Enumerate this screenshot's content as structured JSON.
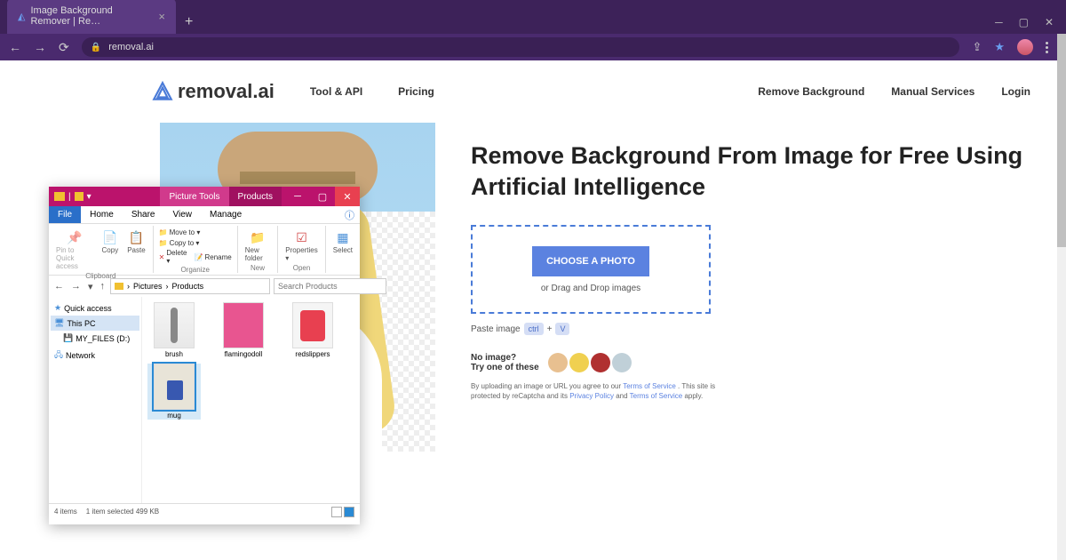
{
  "browser": {
    "tab_title": "Image Background Remover | Re…",
    "url": "removal.ai",
    "new_tab_glyph": "+"
  },
  "site": {
    "logo_text": "removal.ai",
    "nav": {
      "tool_api": "Tool & API",
      "pricing": "Pricing",
      "remove_bg": "Remove Background",
      "manual": "Manual Services",
      "login": "Login"
    },
    "headline": "Remove Background From Image for Free Using Artificial Intelligence",
    "choose_btn": "CHOOSE A PHOTO",
    "drag_text": "or Drag and Drop images",
    "paste_label": "Paste image",
    "key_ctrl": "ctrl",
    "key_plus": "+",
    "key_v": "V",
    "noimg_line1": "No image?",
    "noimg_line2": "Try one of these",
    "terms_pre": "By uploading an image or URL you agree to our ",
    "terms_tos": "Terms of Service",
    "terms_mid": " . This site is protected by reCaptcha and its ",
    "terms_pp": "Privacy Policy",
    "terms_and": " and ",
    "terms_tos2": "Terms of Service",
    "terms_post": " apply."
  },
  "explorer": {
    "title_tabs": {
      "picture_tools": "Picture Tools",
      "products": "Products"
    },
    "menubar": {
      "file": "File",
      "home": "Home",
      "share": "Share",
      "view": "View",
      "manage": "Manage"
    },
    "ribbon": {
      "pin": "Pin to Quick access",
      "copy": "Copy",
      "paste": "Paste",
      "move_to": "Move to ▾",
      "copy_to": "Copy to ▾",
      "delete": "Delete ▾",
      "rename": "Rename",
      "new_folder": "New folder",
      "properties": "Properties ▾",
      "select": "Select",
      "g_clipboard": "Clipboard",
      "g_organize": "Organize",
      "g_new": "New",
      "g_open": "Open"
    },
    "path": {
      "pictures": "Pictures",
      "products": "Products"
    },
    "search_placeholder": "Search Products",
    "sidebar": {
      "quick": "Quick access",
      "this_pc": "This PC",
      "my_files": "MY_FILES (D:)",
      "network": "Network"
    },
    "files": {
      "brush": "brush",
      "flamingodoll": "flamingodoll",
      "redslippers": "redslippers",
      "mug": "mug"
    },
    "status": {
      "count": "4 items",
      "selected": "1 item selected  499 KB"
    }
  }
}
